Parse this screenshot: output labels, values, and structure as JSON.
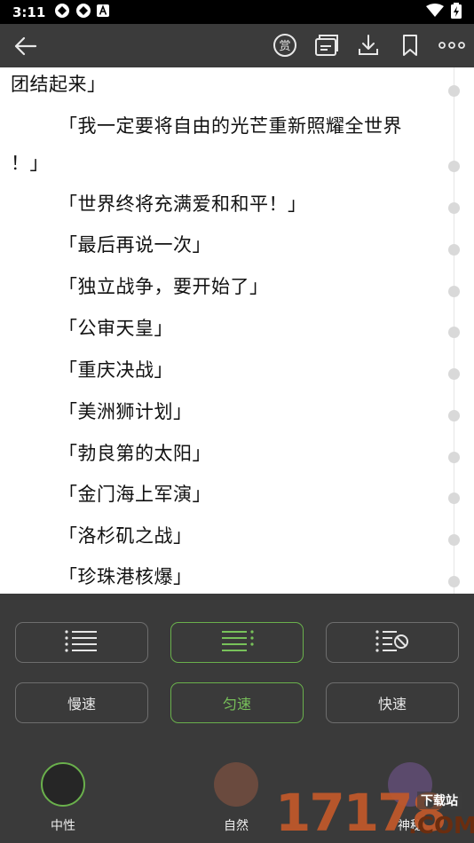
{
  "status_bar": {
    "time": "3:11"
  },
  "book_text": {
    "lines": [
      "团结起来」",
      "「我一定要将自由的光芒重新照耀全世界",
      "！」",
      "「世界终将充满爱和和平！」",
      "「最后再说一次」",
      "「独立战争，要开始了」",
      "「公审天皇」",
      "「重庆决战」",
      "「美洲狮计划」",
      "「勃良第的太阳」",
      "「金门海上军演」",
      "「洛杉矶之战」",
      "「珍珠港核爆」"
    ]
  },
  "controls": {
    "layout_buttons": [
      "list-layout-icon",
      "centered-layout-icon",
      "no-indent-layout-icon"
    ],
    "speed_buttons": [
      "慢速",
      "匀速",
      "快速"
    ],
    "accent_color": "#6ab04c"
  },
  "themes": [
    {
      "label": "中性",
      "color": "#262626",
      "selected": true
    },
    {
      "label": "自然",
      "color": "#6a4a3e",
      "selected": false
    },
    {
      "label": "神秘",
      "color": "#5b4a6c",
      "selected": false
    }
  ],
  "watermark": {
    "digits": "17178",
    "suffix": ".COM",
    "tag": "下载站"
  }
}
